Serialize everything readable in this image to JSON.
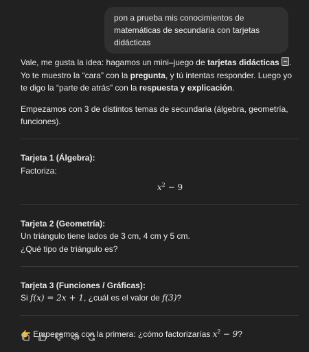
{
  "user_message": {
    "text": "pon a prueba mis conocimientos de matemáticas de secundaria con tarjetas didácticas"
  },
  "assistant": {
    "intro_1a": "Vale, me gusta la idea: hagamos un mini–juego de ",
    "intro_1b": "tarjetas didácticas",
    "intro_1c": ".",
    "intro_2a": "Yo te muestro la “cara” con la ",
    "intro_2b": "pregunta",
    "intro_2c": ", y tú intentas responder. Luego yo te digo la “parte de atrás” con la ",
    "intro_2d": "respuesta y explicación",
    "intro_2e": ".",
    "intro_3": "Empezamos con 3 de distintos temas de secundaria (álgebra, geometría, funciones).",
    "card1": {
      "title": "Tarjeta 1 (Álgebra):",
      "prompt": "Factoriza:",
      "expr_base": "x",
      "expr_exp": "2",
      "expr_rest": " − 9"
    },
    "card2": {
      "title": "Tarjeta 2 (Geometría):",
      "line1": "Un triángulo tiene lados de 3 cm, 4 cm y 5 cm.",
      "line2": "¿Qué tipo de triángulo es?"
    },
    "card3": {
      "title": "Tarjeta 3 (Funciones / Gráficas):",
      "pre": "Si ",
      "math1": "f(x) = 2x + 1",
      "mid": ", ¿cuál es el valor de ",
      "math2": "f(3)",
      "post": "?"
    },
    "closing": {
      "emoji": "👉",
      "pre": " Empecemos con la primera: ¿cómo factorizarías ",
      "math_base": "x",
      "math_exp": "2",
      "math_rest": " − 9",
      "post": "?"
    }
  },
  "actions": [
    {
      "icon": "copy-icon"
    },
    {
      "icon": "thumbs-up-icon"
    },
    {
      "icon": "thumbs-down-icon"
    },
    {
      "icon": "speaker-icon"
    },
    {
      "icon": "regenerate-icon"
    }
  ]
}
